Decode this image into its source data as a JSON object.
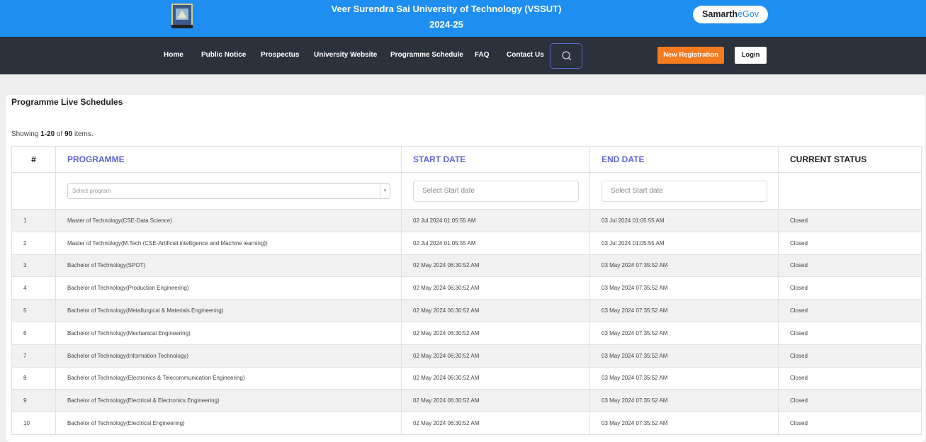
{
  "header": {
    "title": "Veer Surendra Sai University of Technology (VSSUT)",
    "year": "2024-25",
    "brand_main": "Samarth",
    "brand_suffix": "eGov"
  },
  "nav": {
    "items": [
      "Home",
      "Public Notice",
      "Prospectus",
      "University Website",
      "Programme Schedule",
      "FAQ",
      "Contact Us"
    ],
    "new_registration": "New Registration",
    "login": "Login"
  },
  "page": {
    "title": "Programme Live Schedules",
    "summary_prefix": "Showing ",
    "summary_range": "1-20",
    "summary_mid": " of ",
    "summary_total": "90",
    "summary_suffix": " items."
  },
  "table": {
    "headers": [
      "#",
      "PROGRAMME",
      "START DATE",
      "END DATE",
      "CURRENT STATUS"
    ],
    "filters": {
      "program_placeholder": "Select program",
      "start_placeholder": "Select Start date",
      "end_placeholder": "Select Start date"
    },
    "rows": [
      [
        "1",
        "Master of Technology(CSE-Data Science)",
        "02 Jul 2024 01:05:55 AM",
        "03 Jul 2024 01:05:55 AM",
        "Closed"
      ],
      [
        "2",
        "Master of Technology(M.Tech (CSE-Artificial intelligence and Machine learning))",
        "02 Jul 2024 01:05:55 AM",
        "03 Jul 2024 01:05:55 AM",
        "Closed"
      ],
      [
        "3",
        "Bachelor of Technology(SPOT)",
        "02 May 2024 06:30:52 AM",
        "03 May 2024 07:35:52 AM",
        "Closed"
      ],
      [
        "4",
        "Bachelor of Technology(Production Engineering)",
        "02 May 2024 06:30:52 AM",
        "03 May 2024 07:35:52 AM",
        "Closed"
      ],
      [
        "5",
        "Bachelor of Technology(Metallurgical & Materials Engineering)",
        "02 May 2024 06:30:52 AM",
        "03 May 2024 07:35:52 AM",
        "Closed"
      ],
      [
        "6",
        "Bachelor of Technology(Mechanical Engineering)",
        "02 May 2024 06:30:52 AM",
        "03 May 2024 07:35:52 AM",
        "Closed"
      ],
      [
        "7",
        "Bachelor of Technology(Information Technology)",
        "02 May 2024 06:30:52 AM",
        "03 May 2024 07:35:52 AM",
        "Closed"
      ],
      [
        "8",
        "Bachelor of Technology(Electronics & Telecommunication Engineering)",
        "02 May 2024 06:30:52 AM",
        "03 May 2024 07:35:52 AM",
        "Closed"
      ],
      [
        "9",
        "Bachelor of Technology(Electrical & Electronics Engineering)",
        "02 May 2024 06:30:52 AM",
        "03 May 2024 07:35:52 AM",
        "Closed"
      ],
      [
        "10",
        "Bachelor of Technology(Electrical Engineering)",
        "02 May 2024 06:30:52 AM",
        "03 May 2024 07:35:52 AM",
        "Closed"
      ]
    ]
  },
  "icons": {
    "logo": "university-crest-icon",
    "search": "search-icon",
    "dropdown": "chevron-down-icon"
  },
  "colors": {
    "topbar": "#1e8ff0",
    "navbar": "#2b323c",
    "accent_orange": "#f47b20",
    "link_header": "#5e64d6"
  }
}
